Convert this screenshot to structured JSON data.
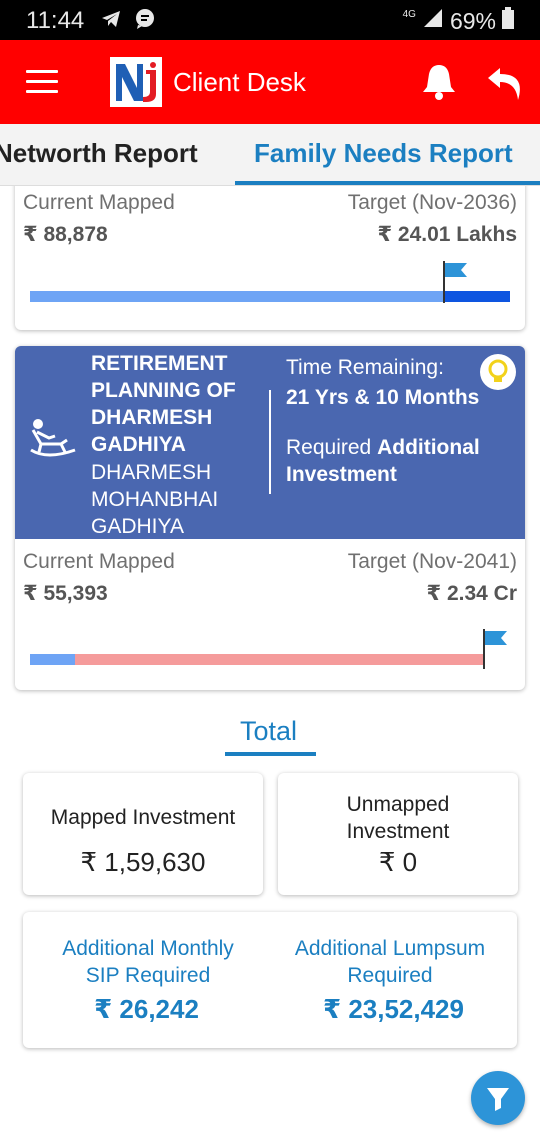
{
  "status_bar": {
    "time": "11:44",
    "network": "4G",
    "battery": "69%"
  },
  "app_bar": {
    "title": "Client Desk",
    "logo_text": "Nj"
  },
  "tabs": [
    {
      "label": "Networth Report",
      "active": false
    },
    {
      "label": "Family Needs Report",
      "active": true
    }
  ],
  "goal_card_top": {
    "current_label": "Current Mapped",
    "current_value": "₹ 88,878",
    "target_label": "Target (Nov-2036)",
    "target_value": "₹ 24.01 Lakhs",
    "progress": 0.86
  },
  "goal_card_retirement": {
    "title": "RETIREMENT PLANNING OF DHARMESH GADHIYA",
    "owner": "DHARMESH MOHANBHAI GADHIYA",
    "time_remaining_label": "Time Remaining:",
    "time_remaining_value": "21 Yrs & 10 Months",
    "required_prefix": "Required",
    "required_bold": "Additional Investment",
    "current_label": "Current Mapped",
    "current_value": "₹ 55,393",
    "target_label": "Target (Nov-2041)",
    "target_value": "₹ 2.34 Cr",
    "progress": 0.1
  },
  "total": {
    "title": "Total",
    "mapped_label": "Mapped Investment",
    "mapped_value": "₹ 1,59,630",
    "unmapped_label": "Unmapped Investment",
    "unmapped_value": "₹ 0",
    "sip_label": "Additional Monthly SIP Required",
    "sip_value": "₹ 26,242",
    "lumpsum_label": "Additional Lumpsum Required",
    "lumpsum_value": "₹ 23,52,429"
  },
  "colors": {
    "app_bar": "#ff0000",
    "accent_blue": "#1b7fc1",
    "goal_header": "#4a67b0",
    "bar_light_blue": "#6ea4f5",
    "bar_dark_blue": "#0e55e0",
    "bar_pink": "#f59b9b",
    "flag_blue": "#2d94d8"
  }
}
